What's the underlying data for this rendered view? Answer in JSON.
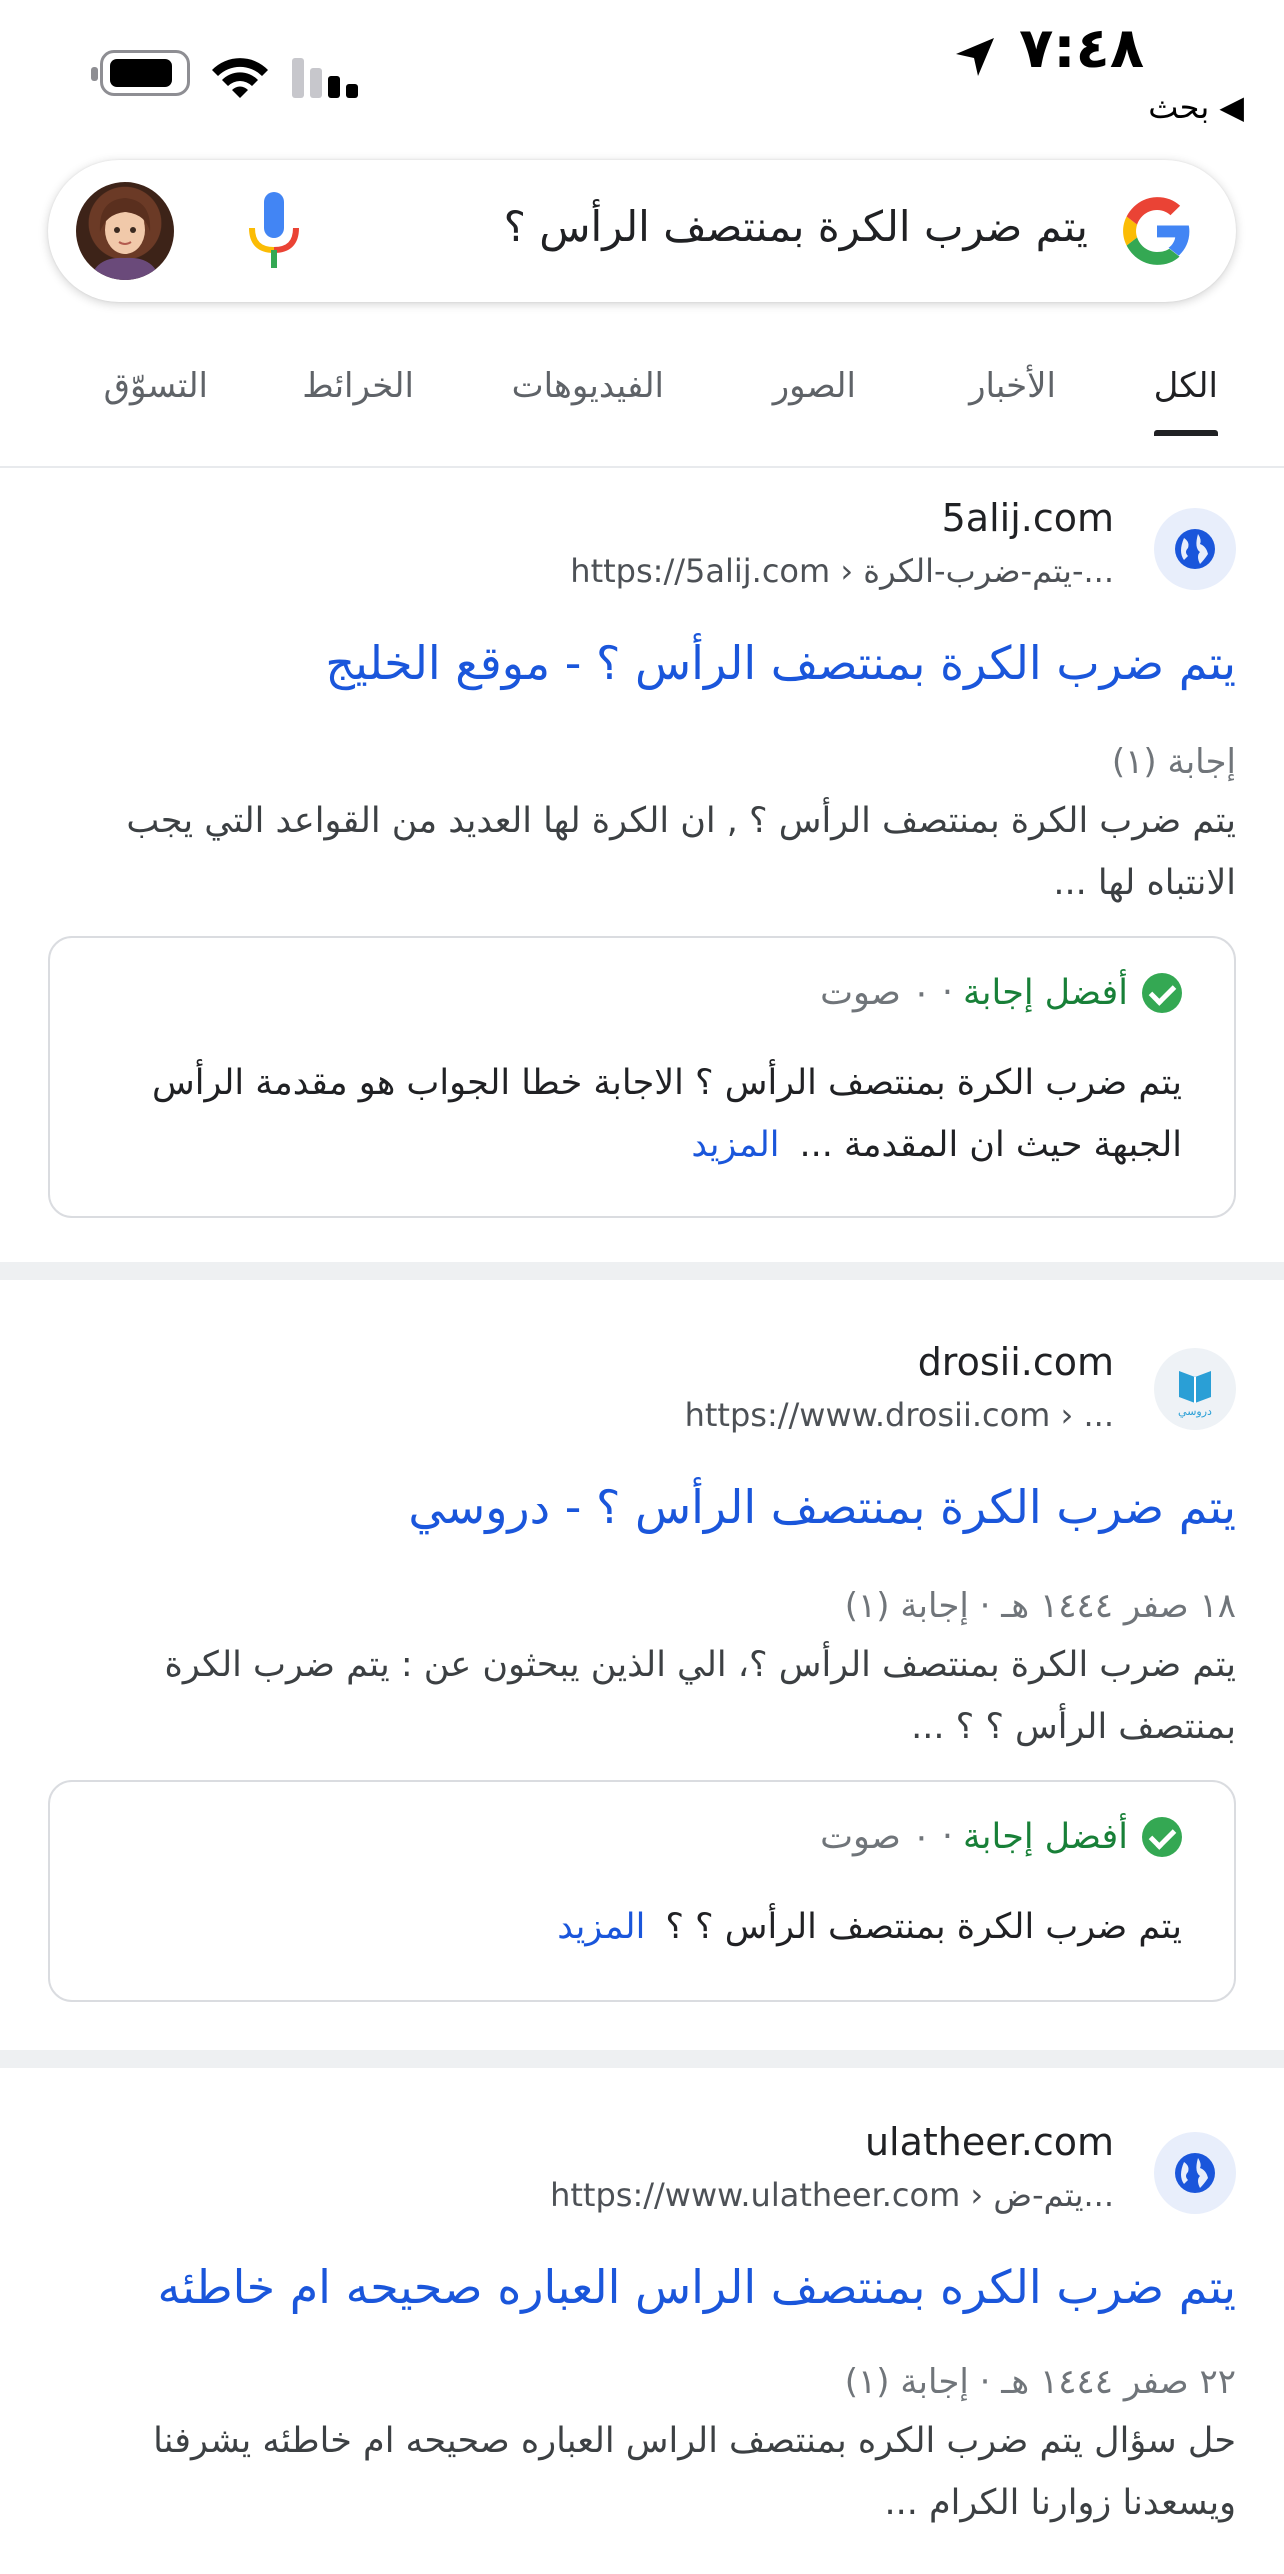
{
  "status_bar": {
    "time": "٧:٤٨",
    "back_label": "◀ بحث"
  },
  "search": {
    "query": "يتم ضرب الكرة بمنتصف الرأس ؟"
  },
  "tabs": [
    {
      "label": "الكل",
      "active": true
    },
    {
      "label": "الأخبار",
      "active": false
    },
    {
      "label": "الصور",
      "active": false
    },
    {
      "label": "الفيديوهات",
      "active": false
    },
    {
      "label": "الخرائط",
      "active": false
    },
    {
      "label": "التسوّق",
      "active": false
    }
  ],
  "results": [
    {
      "site_name": "5alij.com",
      "url": "https://5alij.com › يتم-ضرب-الكرة-...",
      "title": "يتم ضرب الكرة بمنتصف الرأس ؟ - موقع الخليج",
      "meta": "إجابة (١)",
      "snippet": "يتم ضرب الكرة بمنتصف الرأس ؟ , ان الكرة لها العديد من القواعد التي يجب الانتباه لها ...",
      "best_answer_label": "أفضل إجابة",
      "votes": "· ٠ صوت",
      "answer": "يتم ضرب الكرة بمنتصف الرأس ؟ الاجابة خطا الجواب هو مقدمة الرأس الجبهة حيث ان المقدمة ...",
      "more": "المزيد"
    },
    {
      "site_name": "drosii.com",
      "url": "https://www.drosii.com › ...",
      "title": "يتم ضرب الكرة بمنتصف الرأس ؟ - دروسي",
      "meta": "١٨ صفر ١٤٤٤ هـ · إجابة (١)",
      "snippet": "يتم ضرب الكرة بمنتصف الرأس ؟، الي الذين يبحثون عن : يتم ضرب الكرة بمنتصف الرأس ؟ ؟ ...",
      "best_answer_label": "أفضل إجابة",
      "votes": "· ٠ صوت",
      "answer": "يتم ضرب الكرة بمنتصف الرأس ؟ ؟",
      "more": "المزيد",
      "icon_text": "دروسي"
    },
    {
      "site_name": "ulatheer.com",
      "url": "https://www.ulatheer.com › يتم-ض...",
      "title": "يتم ضرب الكره بمنتصف الراس العباره صحيحه ام خاطئه",
      "meta": "٢٢ صفر ١٤٤٤ هـ · إجابة (١)",
      "snippet": "حل سؤال يتم ضرب الكره بمنتصف الراس العباره صحيحه ام خاطئه يشرفنا ويسعدنا زوارنا الكرام ..."
    }
  ],
  "colors": {
    "link_blue": "#1a56db",
    "green": "#188038",
    "divider": "#eef0f2"
  }
}
